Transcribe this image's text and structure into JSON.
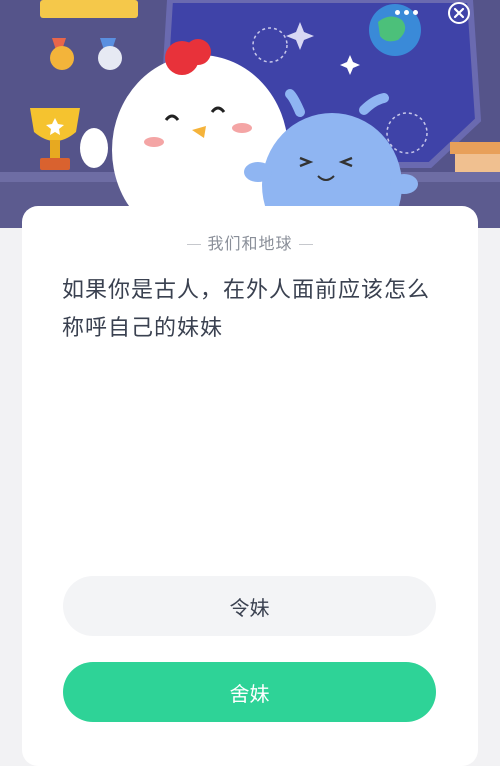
{
  "header": {
    "more_icon": "more-dots-icon",
    "close_icon": "close-circle-icon"
  },
  "quiz": {
    "category": "我们和地球",
    "question": "如果你是古人，在外人面前应该怎么称呼自己的妹妹",
    "options": [
      {
        "label": "令妹"
      },
      {
        "label": "舍妹"
      }
    ]
  },
  "colors": {
    "scene_bg": "#5b5b90",
    "accent_green": "#2ed397",
    "card_bg": "#ffffff",
    "page_bg": "#f2f2f4"
  }
}
